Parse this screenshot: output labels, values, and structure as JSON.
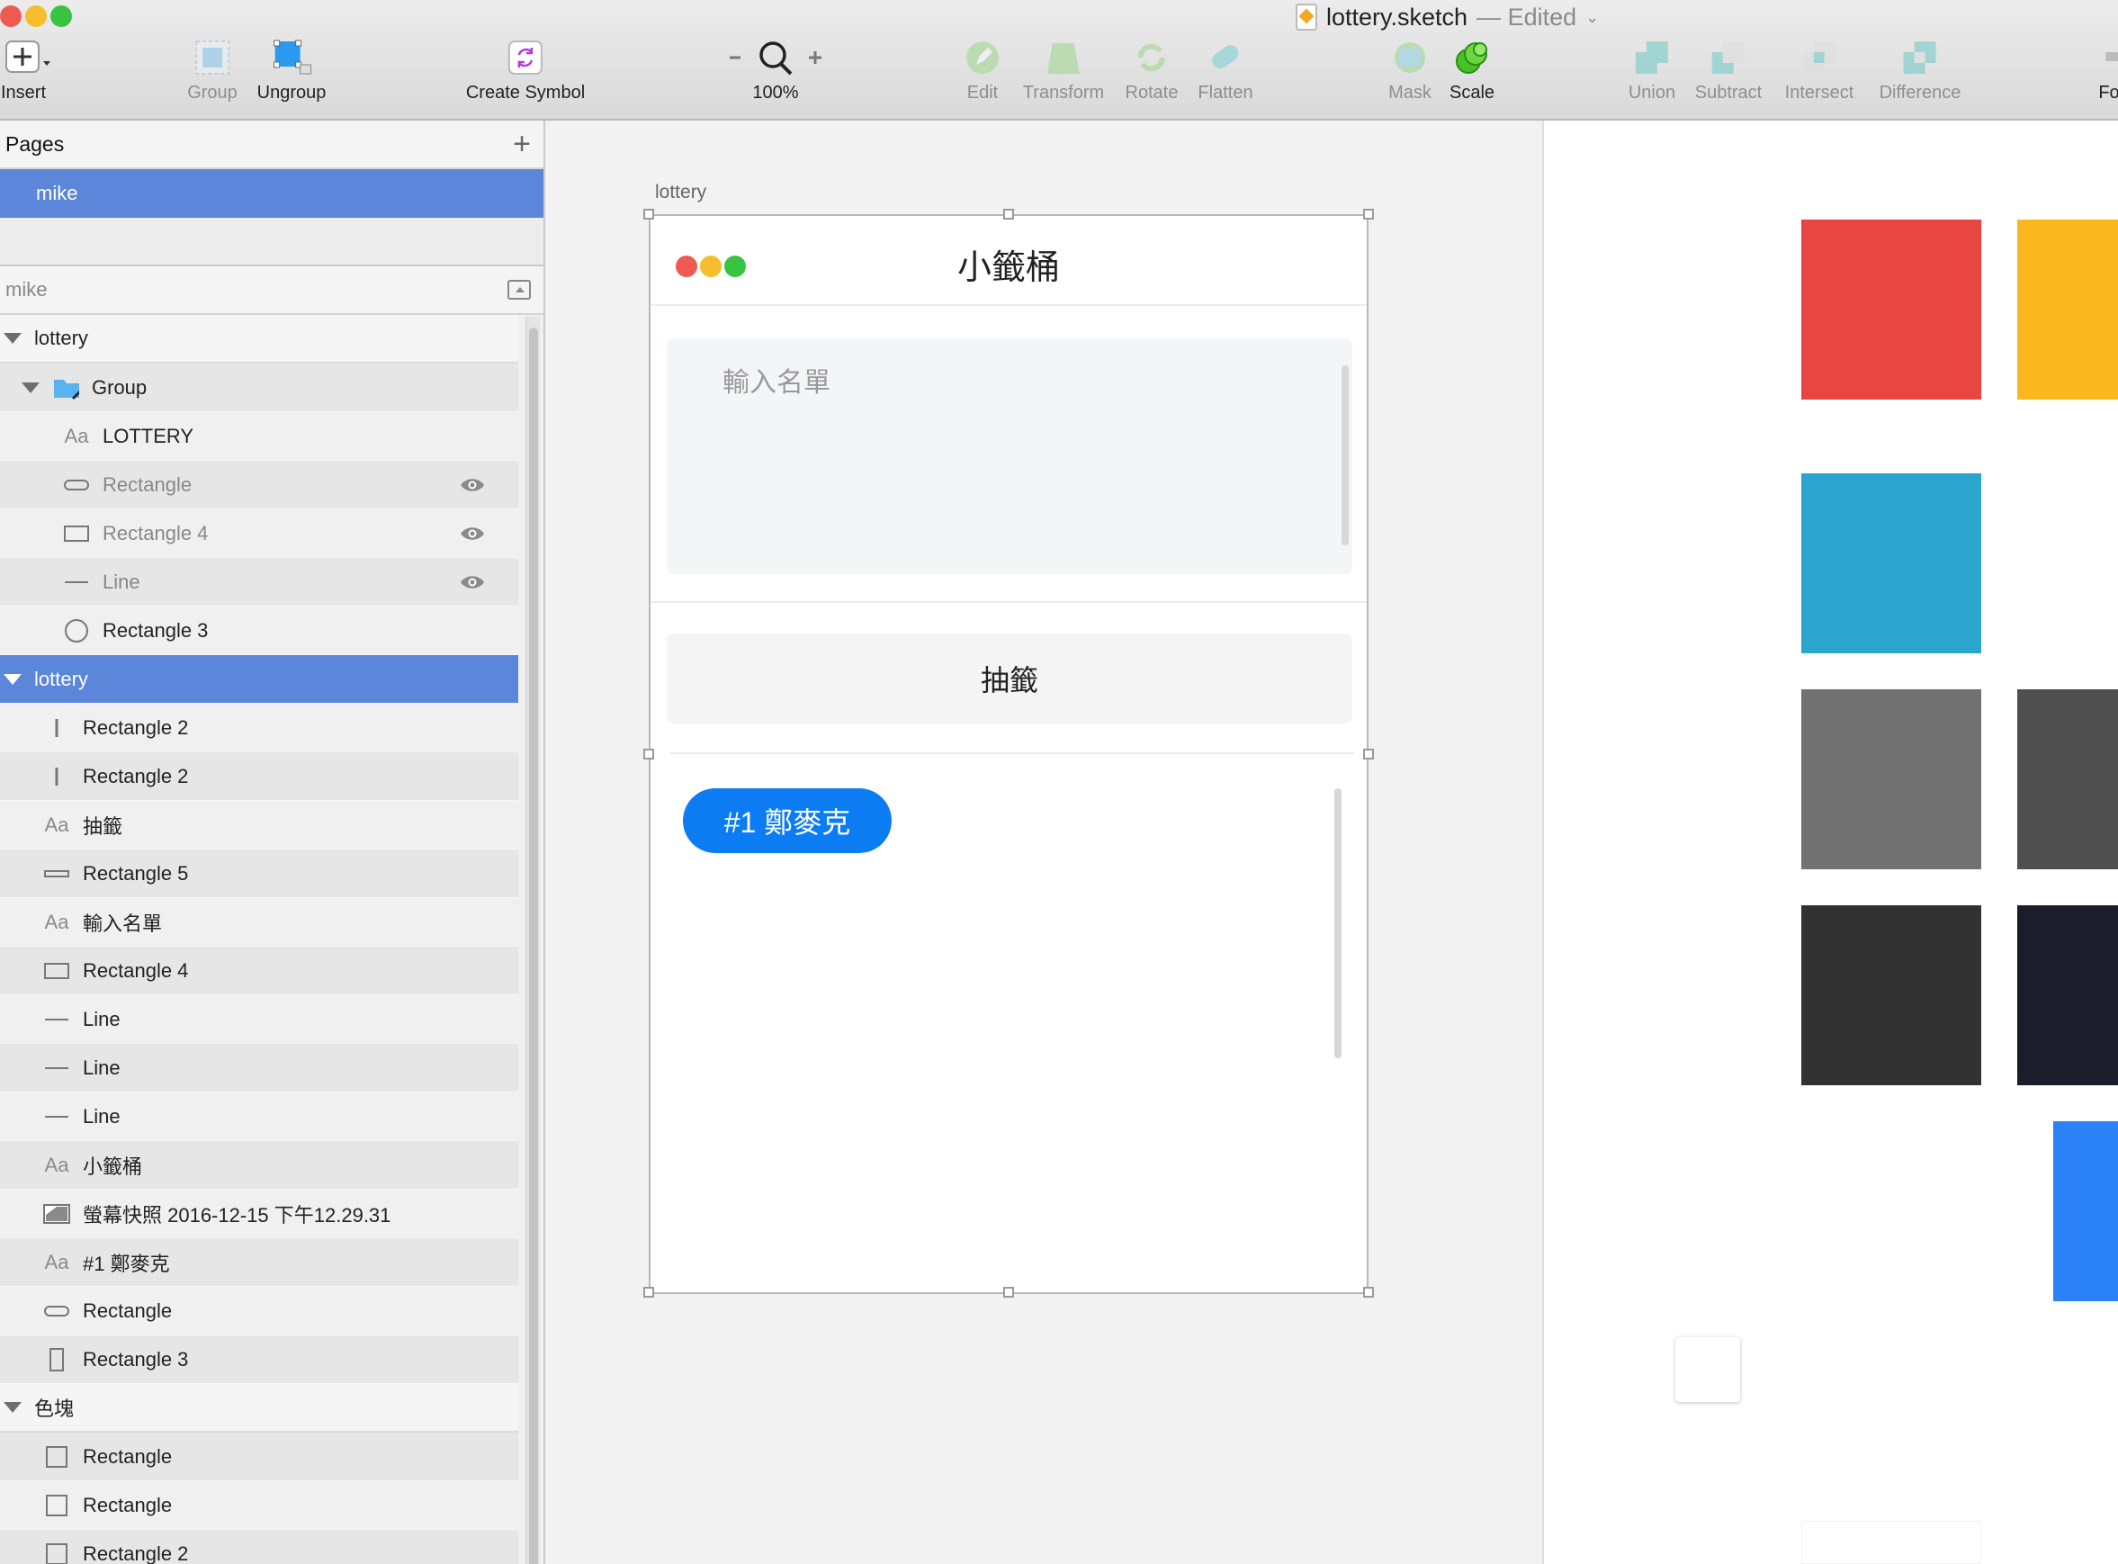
{
  "window": {
    "file_name": "lottery.sketch",
    "status": "— Edited"
  },
  "toolbar": {
    "insert": "Insert",
    "group": "Group",
    "ungroup": "Ungroup",
    "create_symbol": "Create Symbol",
    "zoom": "100%",
    "edit": "Edit",
    "transform": "Transform",
    "rotate": "Rotate",
    "flatten": "Flatten",
    "mask": "Mask",
    "scale": "Scale",
    "union": "Union",
    "subtract": "Subtract",
    "intersect": "Intersect",
    "difference": "Difference",
    "format": "Fo"
  },
  "pages": {
    "header": "Pages",
    "items": [
      "mike"
    ]
  },
  "layers": {
    "header": "mike",
    "rows": [
      {
        "label": "lottery",
        "icon": "disclosure",
        "type": "group"
      },
      {
        "label": "Group",
        "icon": "folder"
      },
      {
        "label": "LOTTERY",
        "icon": "text"
      },
      {
        "label": "Rectangle",
        "icon": "rounded-rect",
        "hidden": true
      },
      {
        "label": "Rectangle 4",
        "icon": "rect",
        "hidden": true
      },
      {
        "label": "Line",
        "icon": "line",
        "hidden": true
      },
      {
        "label": "Rectangle 3",
        "icon": "oval"
      },
      {
        "label": "lottery",
        "icon": "disclosure",
        "type": "group",
        "selected": true
      },
      {
        "label": "Rectangle 2",
        "icon": "vline"
      },
      {
        "label": "Rectangle 2",
        "icon": "vline"
      },
      {
        "label": "抽籤",
        "icon": "text"
      },
      {
        "label": "Rectangle 5",
        "icon": "thin-rect"
      },
      {
        "label": "輸入名單",
        "icon": "text"
      },
      {
        "label": "Rectangle 4",
        "icon": "rect"
      },
      {
        "label": "Line",
        "icon": "line"
      },
      {
        "label": "Line",
        "icon": "line"
      },
      {
        "label": "Line",
        "icon": "line"
      },
      {
        "label": "小籤桶",
        "icon": "text"
      },
      {
        "label": "螢幕快照 2016-12-15 下午12.29.31",
        "icon": "image"
      },
      {
        "label": "#1 鄭麥克",
        "icon": "text"
      },
      {
        "label": "Rectangle",
        "icon": "rounded-rect"
      },
      {
        "label": "Rectangle 3",
        "icon": "tall-rect"
      },
      {
        "label": "色塊",
        "icon": "disclosure",
        "type": "group"
      },
      {
        "label": "Rectangle",
        "icon": "square"
      },
      {
        "label": "Rectangle",
        "icon": "square"
      },
      {
        "label": "Rectangle 2",
        "icon": "square"
      }
    ],
    "text_icon_label": "Aa"
  },
  "canvas": {
    "artboard_label": "lottery",
    "app_title": "小籤桶",
    "name_input_placeholder": "輸入名單",
    "draw_button": "抽籤",
    "result_pill": "#1 鄭麥克"
  },
  "colors": {
    "accent_blue": "#0b7cf2",
    "selection_blue": "#5b86d9",
    "swatches": [
      "#e94542",
      "#fbb81e",
      "#2ba5cd",
      "#717171",
      "#4f4f4f",
      "#323232",
      "#1b1e2a",
      "#2b82f6",
      "#ffffff",
      "#ffffff"
    ]
  }
}
